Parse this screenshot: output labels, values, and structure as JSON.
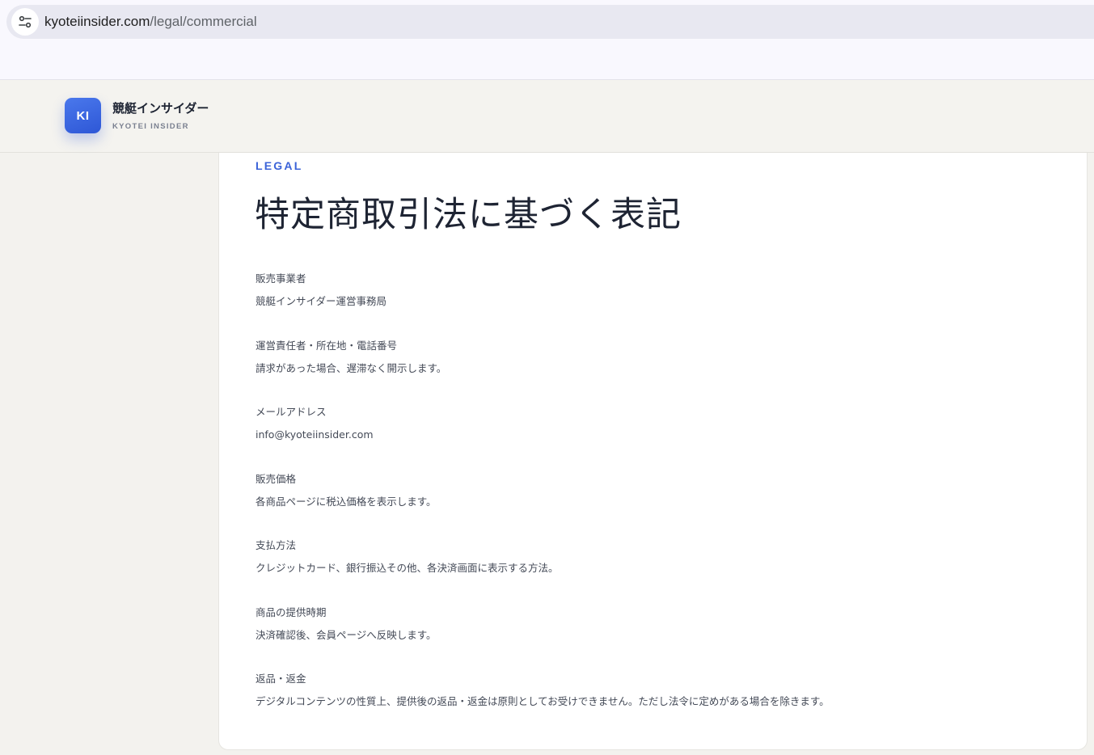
{
  "browser": {
    "url_host": "kyoteiinsider.com",
    "url_path": "/legal/commercial",
    "site_info_icon": "tune-icon"
  },
  "header": {
    "logo_text": "KI",
    "brand_name": "競艇インサイダー",
    "brand_sub": "KYOTEI INSIDER",
    "accent_color": "#3b63d8"
  },
  "page": {
    "eyebrow": "LEGAL",
    "title": "特定商取引法に基づく表記",
    "items": [
      {
        "label": "販売事業者",
        "value": "競艇インサイダー運営事務局"
      },
      {
        "label": "運営責任者・所在地・電話番号",
        "value": "請求があった場合、遅滞なく開示します。"
      },
      {
        "label": "メールアドレス",
        "value": "info@kyoteiinsider.com"
      },
      {
        "label": "販売価格",
        "value": "各商品ページに税込価格を表示します。"
      },
      {
        "label": "支払方法",
        "value": "クレジットカード、銀行振込その他、各決済画面に表示する方法。"
      },
      {
        "label": "商品の提供時期",
        "value": "決済確認後、会員ページへ反映します。"
      },
      {
        "label": "返品・返金",
        "value": "デジタルコンテンツの性質上、提供後の返品・返金は原則としてお受けできません。ただし法令に定めがある場合を除きます。"
      }
    ]
  }
}
